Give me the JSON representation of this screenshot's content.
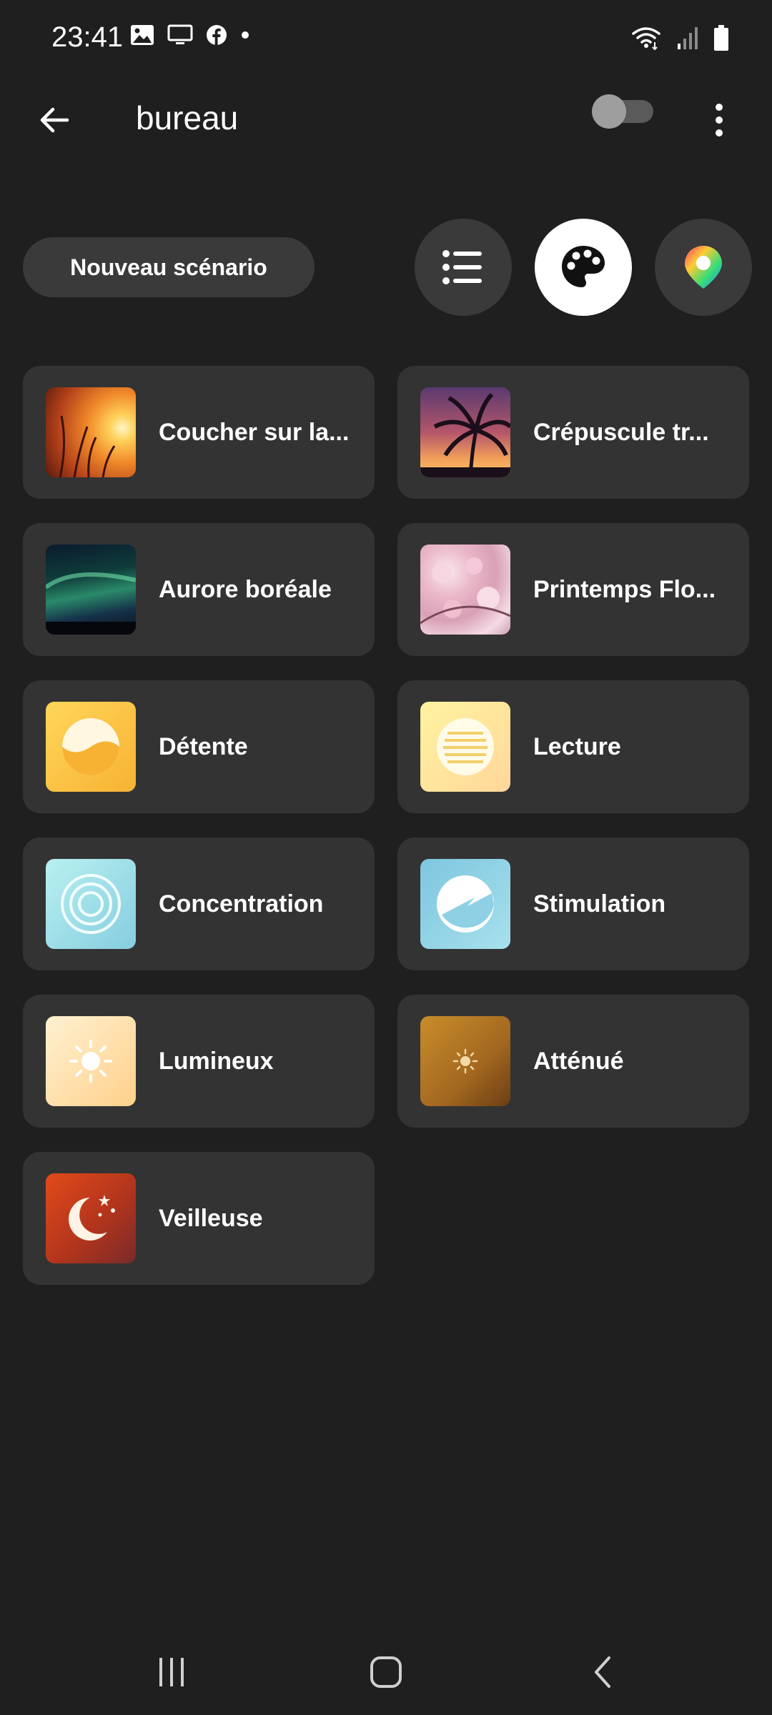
{
  "status_bar": {
    "time": "23:41",
    "left_icons": [
      "gallery-icon",
      "screen-cast-icon",
      "facebook-icon",
      "dot-icon"
    ],
    "right_icons": [
      "wifi-icon",
      "signal-icon",
      "battery-icon"
    ]
  },
  "app_bar": {
    "title": "bureau",
    "toggle_on": false
  },
  "controls": {
    "new_scene_label": "Nouveau scénario",
    "view_modes": [
      "list-view-icon",
      "palette-icon",
      "color-picker-icon"
    ],
    "active_view": "palette-icon"
  },
  "scenes": [
    {
      "label": "Coucher sur la...",
      "thumb": "sunset-photo"
    },
    {
      "label": "Crépuscule tr...",
      "thumb": "palm-dusk-photo"
    },
    {
      "label": "Aurore boréale",
      "thumb": "aurora-photo"
    },
    {
      "label": "Printemps Flo...",
      "thumb": "blossom-photo"
    },
    {
      "label": "Détente",
      "thumb": "relax-icon"
    },
    {
      "label": "Lecture",
      "thumb": "read-icon"
    },
    {
      "label": "Concentration",
      "thumb": "concentrate-icon"
    },
    {
      "label": "Stimulation",
      "thumb": "energize-icon"
    },
    {
      "label": "Lumineux",
      "thumb": "bright-icon"
    },
    {
      "label": "Atténué",
      "thumb": "dimmed-icon"
    },
    {
      "label": "Veilleuse",
      "thumb": "nightlight-icon"
    }
  ],
  "colors": {
    "background": "#1f1f1f",
    "card": "#333333",
    "button": "#3a3a3a"
  },
  "nav_bar": {
    "icons": [
      "recent-apps-icon",
      "home-icon",
      "back-nav-icon"
    ]
  }
}
